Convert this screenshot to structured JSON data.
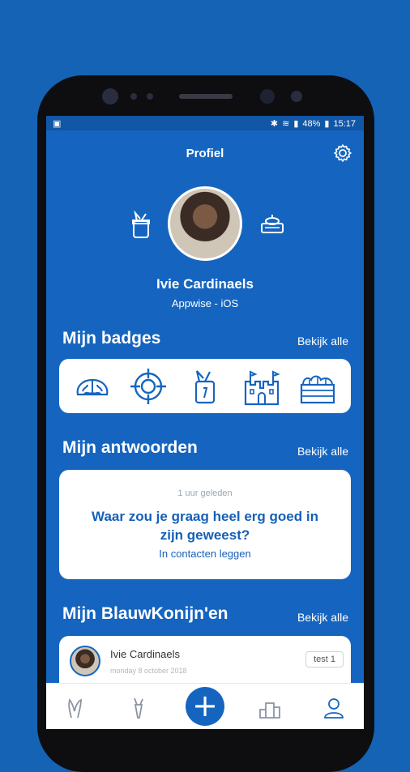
{
  "status_bar": {
    "battery": "48%",
    "time": "15:17"
  },
  "header": {
    "title": "Profiel"
  },
  "profile": {
    "name": "Ivie Cardinaels",
    "subtitle": "Appwise - iOS"
  },
  "badges_section": {
    "title": "Mijn badges",
    "see_all": "Bekijk alle",
    "icons": [
      "brain-icon",
      "target-icon",
      "carrot-jar-icon",
      "castle-icon",
      "crate-icon"
    ]
  },
  "answers_section": {
    "title": "Mijn antwoorden",
    "see_all": "Bekijk alle",
    "card": {
      "time": "1 uur geleden",
      "question": "Waar zou je graag heel erg goed in zijn geweest?",
      "category": "In contacten leggen"
    }
  },
  "blauwkonijn_section": {
    "title": "Mijn BlauwKonijn'en",
    "see_all": "Bekijk alle",
    "item": {
      "name": "Ivie Cardinaels",
      "date": "monday 8 october 2018",
      "tag": "test 1"
    }
  },
  "nav": {
    "items": [
      "rabbit-icon",
      "carrot-icon",
      "plus-icon",
      "podium-icon",
      "profile-icon"
    ],
    "plus_label": "+"
  },
  "colors": {
    "primary": "#1565c0",
    "background": "#1463b5"
  }
}
